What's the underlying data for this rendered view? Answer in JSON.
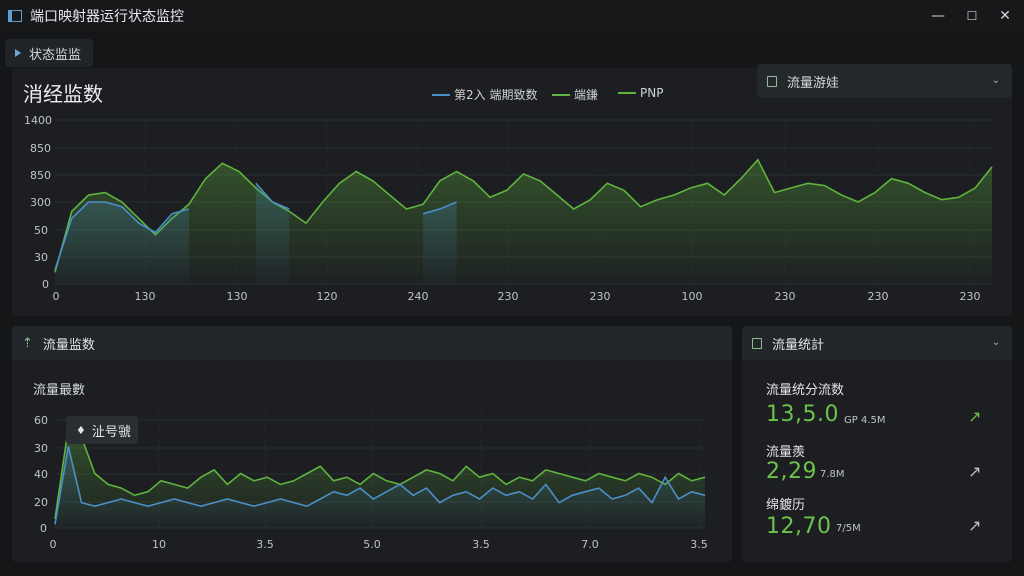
{
  "window": {
    "title": "端口映射器运行状态监控",
    "controls": {
      "minimize": "—",
      "maximize": "☐",
      "close": "✕"
    }
  },
  "tab": {
    "label": "状态监监"
  },
  "main_chart": {
    "title": "消经监数",
    "legend": [
      {
        "name": "第2入 端期致数",
        "color": "#4a8fc7"
      },
      {
        "name": "端鎌",
        "color": "#5fb33e"
      },
      {
        "name": "PNP",
        "color": "#5fb33e"
      }
    ],
    "y_ticks": [
      "1400",
      "850",
      "850",
      "300",
      "50",
      "30",
      "0"
    ],
    "x_ticks": [
      "0",
      "130",
      "130",
      "120",
      "240",
      "230",
      "230",
      "100",
      "230",
      "230",
      "230"
    ]
  },
  "traffic_filter": {
    "label": "流量游娃",
    "icon": "square-icon"
  },
  "traffic_monitor": {
    "header": "流量监数",
    "subtitle": "流量最數",
    "tooltip": "沚号虢",
    "y_ticks": [
      "60",
      "30",
      "40",
      "20",
      "0"
    ],
    "x_ticks": [
      "0",
      "10",
      "3.5",
      "5.0",
      "3.5",
      "7.0",
      "3.5"
    ]
  },
  "traffic_stats": {
    "header": "流量统計",
    "items": [
      {
        "label": "流量统分流数",
        "value": "13,5.0",
        "unit": "GP 4.5M",
        "arrow": "↗",
        "arrow_color": "#6cc24a"
      },
      {
        "label": "流量羨",
        "value": "2,29",
        "unit": "7.8M",
        "arrow": "↗",
        "arrow_color": "#bfc3c7"
      },
      {
        "label": "绵鍍历",
        "value": "12,70",
        "unit": "7/5M",
        "arrow": "↗",
        "arrow_color": "#bfc3c7"
      }
    ]
  },
  "chart_data": [
    {
      "type": "area",
      "ylim": [
        0,
        1400
      ],
      "series": [
        {
          "name": "端鎌",
          "color": "#5fb33e",
          "values": [
            100,
            620,
            760,
            780,
            700,
            560,
            420,
            560,
            680,
            900,
            1030,
            960,
            820,
            700,
            620,
            520,
            700,
            860,
            960,
            880,
            760,
            640,
            680,
            880,
            960,
            880,
            740,
            800,
            940,
            880,
            760,
            640,
            720,
            860,
            800,
            660,
            720,
            760,
            820,
            860,
            760,
            900,
            1060,
            780,
            820,
            860,
            840,
            760,
            700,
            780,
            900,
            860,
            780,
            720,
            740,
            820,
            1000
          ]
        },
        {
          "name": "第2入 端期致数",
          "color": "#4a8fc7",
          "values": [
            120,
            560,
            700,
            700,
            660,
            520,
            440,
            600,
            640,
            null,
            null,
            null,
            860,
            700,
            640,
            null,
            null,
            null,
            null,
            null,
            null,
            null,
            600,
            640,
            700,
            null,
            null,
            null,
            null,
            null,
            null,
            null,
            null,
            null,
            null,
            null,
            null,
            null,
            null,
            null,
            null,
            null,
            null,
            null,
            null,
            null,
            null,
            null,
            null,
            null,
            null,
            null,
            null,
            null,
            null,
            null,
            null
          ]
        }
      ]
    },
    {
      "type": "area",
      "ylim": [
        0,
        65
      ],
      "series": [
        {
          "name": "green",
          "color": "#5fb33e",
          "values": [
            5,
            55,
            50,
            30,
            24,
            22,
            18,
            20,
            26,
            24,
            22,
            28,
            32,
            24,
            30,
            26,
            28,
            24,
            26,
            30,
            34,
            26,
            28,
            24,
            30,
            26,
            24,
            28,
            32,
            30,
            26,
            34,
            28,
            30,
            24,
            28,
            26,
            32,
            30,
            28,
            26,
            30,
            28,
            26,
            30,
            28,
            24,
            30,
            26,
            28
          ]
        },
        {
          "name": "blue",
          "color": "#4a8fc7",
          "values": [
            2,
            45,
            14,
            12,
            14,
            16,
            14,
            12,
            14,
            16,
            14,
            12,
            14,
            16,
            14,
            12,
            14,
            16,
            14,
            12,
            16,
            20,
            18,
            22,
            16,
            20,
            24,
            18,
            22,
            14,
            18,
            20,
            16,
            22,
            18,
            20,
            16,
            24,
            14,
            18,
            20,
            22,
            16,
            18,
            22,
            14,
            28,
            16,
            20,
            18
          ]
        }
      ]
    }
  ]
}
